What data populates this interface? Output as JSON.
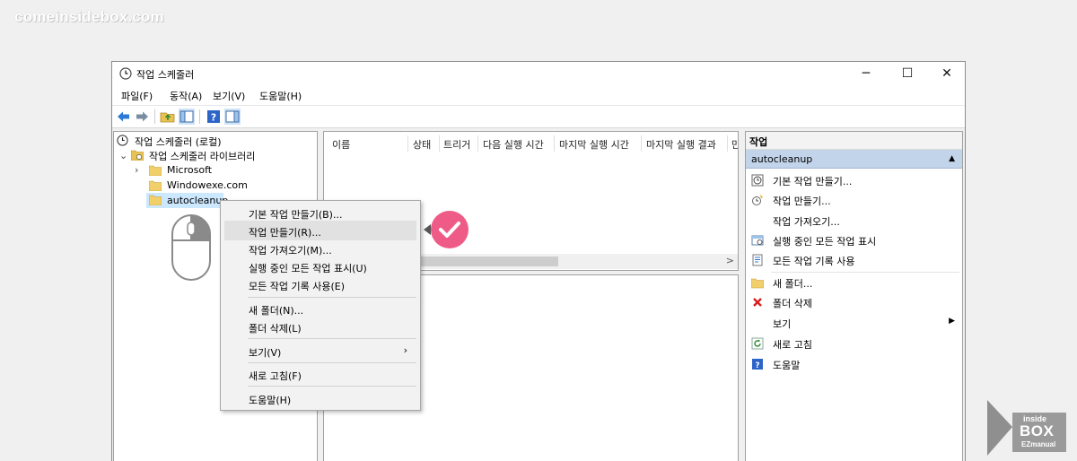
{
  "site": {
    "watermark": "comeinsidebox.com"
  },
  "window": {
    "title": "작업 스케줄러",
    "minimize_glyph": "─",
    "maximize_glyph": "☐",
    "close_glyph": "✕"
  },
  "menu": [
    "파일(F)",
    "동작(A)",
    "보기(V)",
    "도움말(H)"
  ],
  "toolbar": {
    "icons": [
      "back-arrow-icon",
      "forward-arrow-icon",
      "up-folder-icon",
      "show-hide-tree-icon",
      "help-icon",
      "show-hide-action-pane-icon"
    ]
  },
  "tree": {
    "root": "작업 스케줄러 (로컬)",
    "library": "작업 스케줄러 라이브러리",
    "items": [
      "Microsoft",
      "Windowexe.com",
      "autocleanup"
    ],
    "selected": "autocleanup"
  },
  "list": {
    "columns": [
      "이름",
      "상태",
      "트리거",
      "다음 실행 시간",
      "마지막 실행 시간",
      "마지막 실행 결과",
      "만"
    ],
    "scroll_arrow": ">"
  },
  "actions": {
    "header": "작업",
    "section": "autocleanup",
    "section_arrow": "▲",
    "items": [
      {
        "label": "기본 작업 만들기...",
        "icon": "basic-task-icon"
      },
      {
        "label": "작업 만들기...",
        "icon": "create-task-icon"
      },
      {
        "label": "작업 가져오기...",
        "icon": ""
      },
      {
        "label": "실행 중인 모든 작업 표시",
        "icon": "running-tasks-icon"
      },
      {
        "label": "모든 작업 기록 사용",
        "icon": "task-history-icon"
      },
      {
        "label": "새 폴더...",
        "icon": "new-folder-icon"
      },
      {
        "label": "폴더 삭제",
        "icon": "delete-icon"
      },
      {
        "label": "보기",
        "icon": "",
        "submenu": true
      },
      {
        "label": "새로 고침",
        "icon": "refresh-icon"
      },
      {
        "label": "도움말",
        "icon": "help-icon"
      }
    ],
    "submenu_arrow": "▶"
  },
  "context_menu": {
    "items": [
      "기본 작업 만들기(B)...",
      "작업 만들기(R)...",
      "작업 가져오기(M)...",
      "실행 중인 모든 작업 표시(U)",
      "모든 작업 기록 사용(E)",
      "새 폴더(N)...",
      "폴더 삭제(L)",
      "보기(V)",
      "새로 고침(F)",
      "도움말(H)"
    ],
    "highlighted": "작업 만들기(R)...",
    "submenu_arrow": "›"
  },
  "logo": {
    "line1": "inside",
    "line2": "BOX",
    "line3": "EZmanual"
  },
  "colors": {
    "selection": "#cce8ff",
    "action_section": "#c2d4e9",
    "check_badge": "#ef5b87",
    "menu_highlight": "#e1e1e1"
  }
}
